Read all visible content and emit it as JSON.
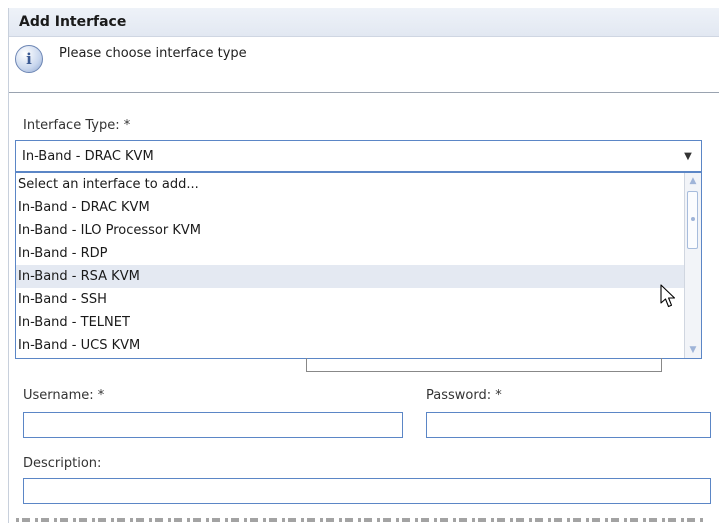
{
  "dialog": {
    "title": "Add Interface",
    "info_message": "Please choose interface type"
  },
  "interface_type": {
    "label": "Interface Type: *",
    "selected": "In-Band - DRAC KVM",
    "options": [
      "Select an interface to add...",
      "In-Band - DRAC KVM",
      "In-Band - ILO Processor KVM",
      "In-Band - RDP",
      "In-Band - RSA KVM",
      "In-Band - SSH",
      "In-Band - TELNET",
      "In-Band - UCS KVM"
    ],
    "hovered_option": "In-Band - RSA KVM"
  },
  "username": {
    "label": "Username: *",
    "value": ""
  },
  "password": {
    "label": "Password: *",
    "value": ""
  },
  "description": {
    "label": "Description:",
    "value": ""
  },
  "icons": {
    "info": "info-icon",
    "dropdown_arrow": "chevron-down-icon",
    "scroll_up": "scroll-up-arrow-icon",
    "scroll_down": "scroll-down-arrow-icon",
    "cursor": "mouse-pointer-icon"
  },
  "colors": {
    "accent_border": "#5b86c6",
    "hover_row": "#e4e9f2",
    "title_bar": "#e2e8f2"
  }
}
